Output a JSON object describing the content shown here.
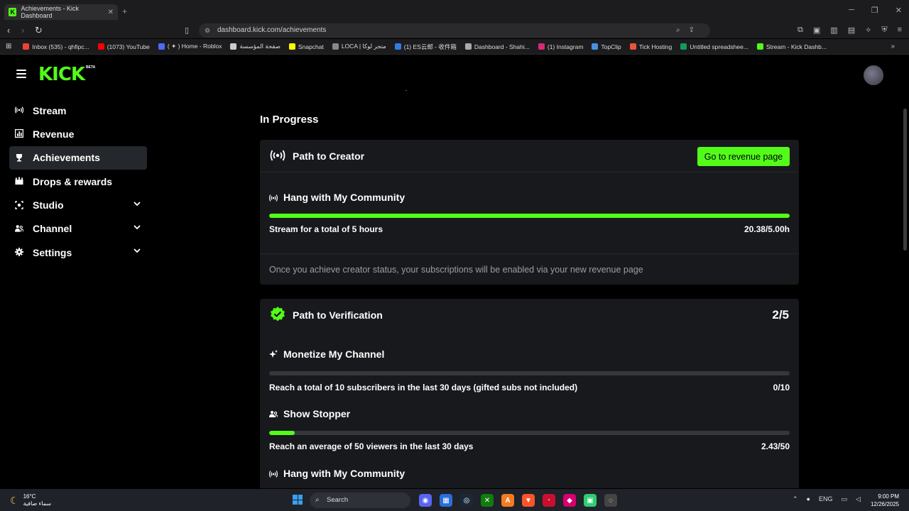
{
  "browser": {
    "tab_title": "Achievements - Kick Dashboard",
    "tab_close": "✕",
    "new_tab": "+",
    "url": "dashboard.kick.com/achievements",
    "bookmarks": [
      {
        "label": "Inbox (535) - qhfipc...",
        "color": "#ea4335"
      },
      {
        "label": "(1073) YouTube",
        "color": "#ff0000"
      },
      {
        "label": "( ✦ ) Home - Roblox",
        "color": "#4a6cf7"
      },
      {
        "label": "صفحة المؤسسة",
        "color": "#cccccc"
      },
      {
        "label": "Snapchat",
        "color": "#fffc00"
      },
      {
        "label": "LOCA | متجر لوكا",
        "color": "#888888"
      },
      {
        "label": "(1) ES云邮 - 收件箱",
        "color": "#2f7de1"
      },
      {
        "label": "Dashboard - Shahi...",
        "color": "#aaaaaa"
      },
      {
        "label": "(1) Instagram",
        "color": "#d62976"
      },
      {
        "label": "TopClip",
        "color": "#4a90e2"
      },
      {
        "label": "Tick Hosting",
        "color": "#e8553b"
      },
      {
        "label": "Untitled spreadshee...",
        "color": "#0f9d58"
      },
      {
        "label": "Stream - Kick Dashb...",
        "color": "#53fc18"
      }
    ],
    "bookmarks_more": "»"
  },
  "header": {
    "logo": "KICK",
    "logo_badge": "BETA"
  },
  "sidebar": {
    "items": [
      {
        "label": "Stream",
        "icon": "broadcast-icon"
      },
      {
        "label": "Revenue",
        "icon": "chart-icon"
      },
      {
        "label": "Achievements",
        "icon": "trophy-icon"
      },
      {
        "label": "Drops & rewards",
        "icon": "gift-icon"
      },
      {
        "label": "Studio",
        "icon": "camera-icon"
      },
      {
        "label": "Channel",
        "icon": "users-icon"
      },
      {
        "label": "Settings",
        "icon": "gear-icon"
      }
    ]
  },
  "main": {
    "section_title": "In Progress",
    "card1": {
      "title": "Path to Creator",
      "button": "Go to revenue page",
      "achievement": {
        "title": "Hang with My Community",
        "task": "Stream for a total of 5 hours",
        "value": "20.38/5.00h",
        "progress": 1.0
      },
      "footer": "Once you achieve creator status, your subscriptions will be enabled via your new revenue page"
    },
    "card2": {
      "title": "Path to Verification",
      "count": "2/5",
      "achievements": [
        {
          "title": "Monetize My Channel",
          "task": "Reach a total of 10 subscribers in the last 30 days (gifted subs not included)",
          "value": "0/10",
          "progress": 0.0
        },
        {
          "title": "Show Stopper",
          "task": "Reach an average of 50 viewers in the last 30 days",
          "value": "2.43/50",
          "progress": 0.0486
        },
        {
          "title": "Hang with My Community"
        }
      ]
    }
  },
  "taskbar": {
    "temp": "16°C",
    "weather": "سماء صافية",
    "search": "Search",
    "lang": "ENG",
    "time": "9:00 PM",
    "date": "12/26/2025"
  },
  "colors": {
    "accent": "#53fc18",
    "card_bg": "#18191c",
    "track": "#35373b",
    "muted_text": "#9b9ea3"
  }
}
